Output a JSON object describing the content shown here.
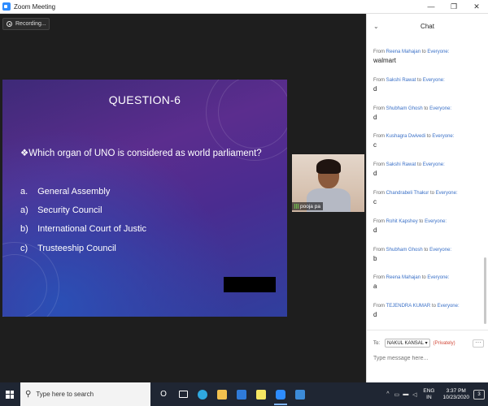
{
  "window": {
    "title": "Zoom Meeting",
    "minimize": "—",
    "restore": "❐",
    "close": "✕"
  },
  "recording": {
    "label": "Recording..."
  },
  "slide": {
    "question_title": "QUESTION-6",
    "question_text": "❖Which organ of UNO is considered as world parliament?",
    "options": [
      {
        "letter": "a.",
        "text": "General  Assembly"
      },
      {
        "letter": "a)",
        "text": "Security Council"
      },
      {
        "letter": "b)",
        "text": "International Court of Justic"
      },
      {
        "letter": "c)",
        "text": "Trusteeship Council"
      }
    ]
  },
  "participant": {
    "name": "pooja pa"
  },
  "chat": {
    "title": "Chat",
    "collapse_icon": "chevron-down-icon",
    "from_label": "From",
    "to_everyone": "to",
    "messages": [
      {
        "from": "Reena Mahajan",
        "to": "Everyone:",
        "text": "walmart"
      },
      {
        "from": "Sakshi Rawat",
        "to": "Everyone:",
        "text": "d"
      },
      {
        "from": "Shubham Ghosh",
        "to": "Everyone:",
        "text": "d"
      },
      {
        "from": "Kushagra Dwivedi",
        "to": "Everyone:",
        "text": "c"
      },
      {
        "from": "Sakshi Rawat",
        "to": "Everyone:",
        "text": "d"
      },
      {
        "from": "Chandrabeli Thakur",
        "to": "Everyone:",
        "text": "c"
      },
      {
        "from": "Rohit Kapshey",
        "to": "Everyone:",
        "text": "d"
      },
      {
        "from": "Shubham Ghosh",
        "to": "Everyone:",
        "text": "b"
      },
      {
        "from": "Reena Mahajan",
        "to": "Everyone:",
        "text": "a"
      },
      {
        "from": "TEJENDRA KUMAR",
        "to": "Everyone:",
        "text": "d"
      }
    ],
    "to_label": "To:",
    "recipient": "NAKUL KANSAL ▾",
    "privately": "(Privately)",
    "more": "···",
    "input_placeholder": "Type message here..."
  },
  "taskbar": {
    "search_placeholder": "Type here to search",
    "cortana": "O",
    "tray_up": "^",
    "language_line1": "ENG",
    "language_line2": "IN",
    "time": "3:37 PM",
    "date": "10/23/2020",
    "notification_count": "3",
    "icons": [
      {
        "name": "task-view-icon",
        "color": "#ffffff"
      },
      {
        "name": "edge-icon",
        "color": "#2fa9e0"
      },
      {
        "name": "file-explorer-icon",
        "color": "#f2c14e"
      },
      {
        "name": "mail-icon",
        "color": "#2f7bd9"
      },
      {
        "name": "sticky-notes-icon",
        "color": "#f5e663"
      },
      {
        "name": "zoom-icon",
        "color": "#2d8cff"
      },
      {
        "name": "photos-icon",
        "color": "#3c8bd8"
      }
    ]
  },
  "colors": {
    "slide_purple": "#5b2d8e",
    "chat_name_blue": "#3a70c7",
    "privately_red": "#d24a3a",
    "taskbar_bg": "#1f2633"
  }
}
